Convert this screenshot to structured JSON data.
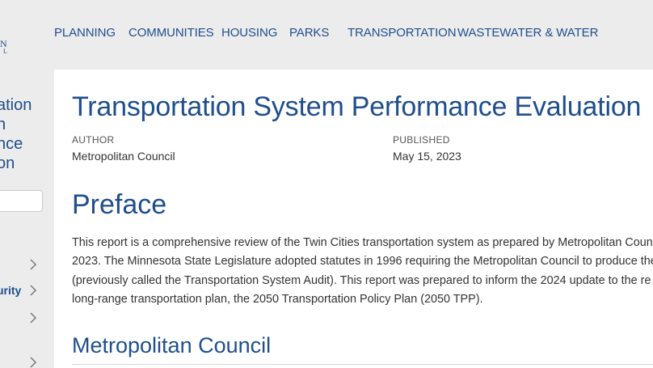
{
  "nav": {
    "items": [
      "PLANNING",
      "COMMUNITIES",
      "HOUSING",
      "PARKS",
      "TRANSPORTATION",
      "WASTEWATER & WATER"
    ]
  },
  "logo": {
    "line1": "N",
    "line2": "L"
  },
  "sidebar": {
    "title_lines": [
      "ation",
      "n",
      "nce",
      "on"
    ],
    "active_item": "urity"
  },
  "doc": {
    "title": "Transportation System Performance Evaluation",
    "author_label": "AUTHOR",
    "author": "Metropolitan Council",
    "published_label": "PUBLISHED",
    "published": "May 15, 2023",
    "preface_heading": "Preface",
    "preface_lines": [
      "This report is a comprehensive review of the Twin Cities transportation system as prepared by Metropolitan Council",
      "2023. The Minnesota State Legislature adopted statutes in 1996 requiring the Metropolitan Council to produce the",
      "(previously called the Transportation System Audit). This report was prepared to inform the 2024 update to the re",
      "long-range transportation plan, the 2050 Transportation Policy Plan (2050 TPP)."
    ],
    "section_heading": "Metropolitan Council"
  },
  "colors": {
    "brand": "#1f4e8c",
    "text": "#333333",
    "chrome": "#ececec"
  },
  "icons": {
    "chevron": "chevron-right-icon"
  }
}
